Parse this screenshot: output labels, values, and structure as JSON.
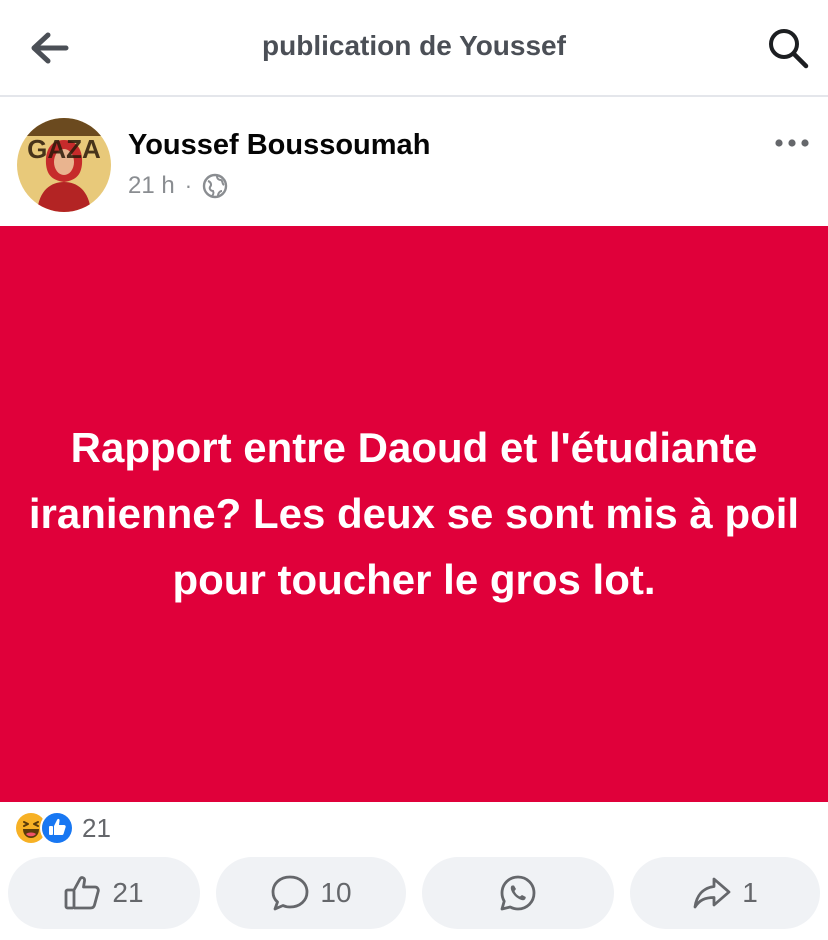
{
  "header": {
    "title": "publication de Youssef",
    "back_icon": "arrow-left-icon",
    "search_icon": "search-icon"
  },
  "post": {
    "author": "Youssef Boussoumah",
    "avatar_text": "GAZA",
    "time": "21 h",
    "separator": "·",
    "privacy_icon": "globe-icon",
    "more_icon": "more-horizontal-icon",
    "text": "Rapport entre Daoud et l'étudiante iranienne? Les deux se sont mis à poil pour toucher le gros lot.",
    "background_color": "#e0003a",
    "text_color": "#ffffff"
  },
  "reactions": {
    "icons": [
      "haha-icon",
      "like-icon"
    ],
    "count": "21"
  },
  "actions": {
    "like_count": "21",
    "comment_count": "10",
    "share_count": "1",
    "like_icon": "thumbs-up-icon",
    "comment_icon": "comment-icon",
    "whatsapp_icon": "whatsapp-icon",
    "share_icon": "share-icon"
  },
  "colors": {
    "accent": "#1877f2",
    "haha": "#f7b125"
  }
}
